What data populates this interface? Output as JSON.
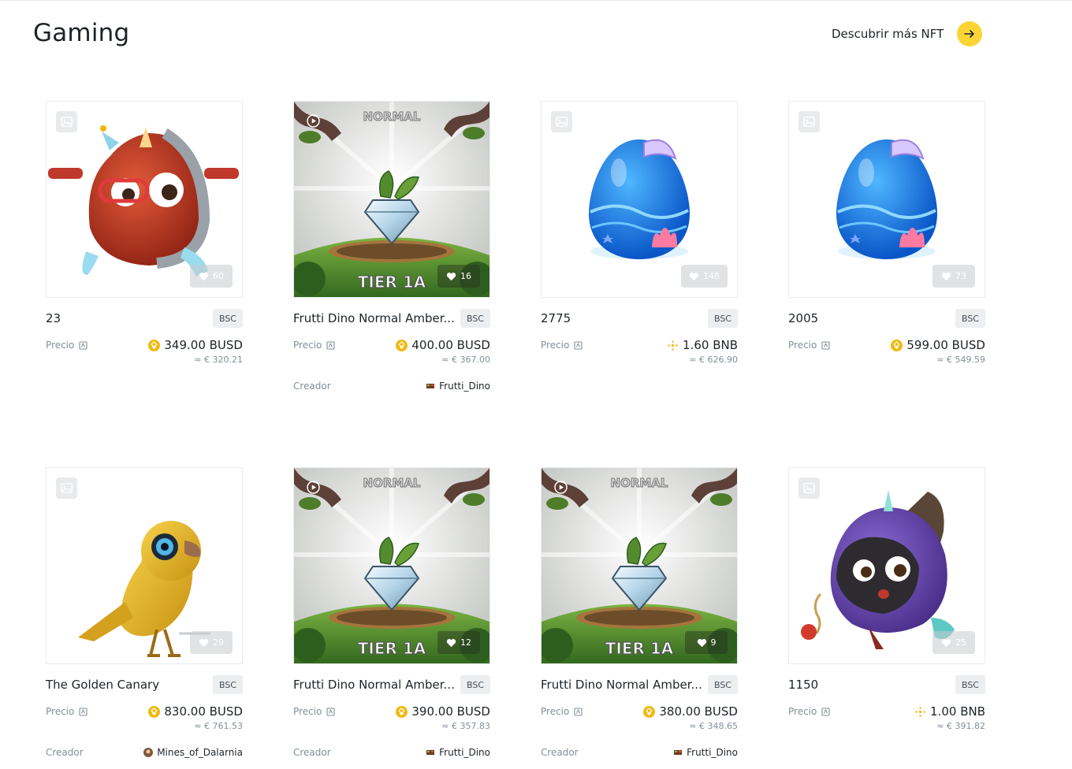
{
  "page": {
    "title": "Gaming",
    "discover_label": "Descubrir más NFT"
  },
  "colors": {
    "accent": "#fcd535",
    "text": "#1e2329",
    "muted": "#848e9c"
  },
  "labels": {
    "price": "Precio",
    "creator": "Creador"
  },
  "items": [
    {
      "name": "23",
      "chain": "BSC",
      "price": "349.00 BUSD",
      "fiat": "≈ € 320.21",
      "likes": "60",
      "token": "busd",
      "media": "image",
      "art": "robot-red"
    },
    {
      "name": "Frutti Dino Normal Amber...",
      "chain": "BSC",
      "price": "400.00 BUSD",
      "fiat": "≈ € 367.00",
      "likes": "16",
      "token": "busd",
      "media": "video",
      "art": "tier",
      "creator": "Frutti_Dino"
    },
    {
      "name": "2775",
      "chain": "BSC",
      "price": "1.60 BNB",
      "fiat": "≈ € 626.90",
      "likes": "148",
      "token": "bnb",
      "media": "image",
      "art": "egg"
    },
    {
      "name": "2005",
      "chain": "BSC",
      "price": "599.00 BUSD",
      "fiat": "≈ € 549.59",
      "likes": "73",
      "token": "busd",
      "media": "image",
      "art": "egg"
    },
    {
      "name": "The Golden Canary",
      "chain": "BSC",
      "price": "830.00 BUSD",
      "fiat": "≈ € 761.53",
      "likes": "29",
      "token": "busd",
      "media": "image",
      "art": "canary",
      "creator": "Mines_of_Dalarnia"
    },
    {
      "name": "Frutti Dino Normal Amber...",
      "chain": "BSC",
      "price": "390.00 BUSD",
      "fiat": "≈ € 357.83",
      "likes": "12",
      "token": "busd",
      "media": "video",
      "art": "tier",
      "creator": "Frutti_Dino"
    },
    {
      "name": "Frutti Dino Normal Amber...",
      "chain": "BSC",
      "price": "380.00 BUSD",
      "fiat": "≈ € 348.65",
      "likes": "9",
      "token": "busd",
      "media": "video",
      "art": "tier",
      "creator": "Frutti_Dino"
    },
    {
      "name": "1150",
      "chain": "BSC",
      "price": "1.00 BNB",
      "fiat": "≈ € 391.82",
      "likes": "25",
      "token": "bnb",
      "media": "image",
      "art": "robot-purple"
    }
  ],
  "art_text": {
    "tier_top": "NORMAL",
    "tier_bottom": "TIER 1A"
  }
}
